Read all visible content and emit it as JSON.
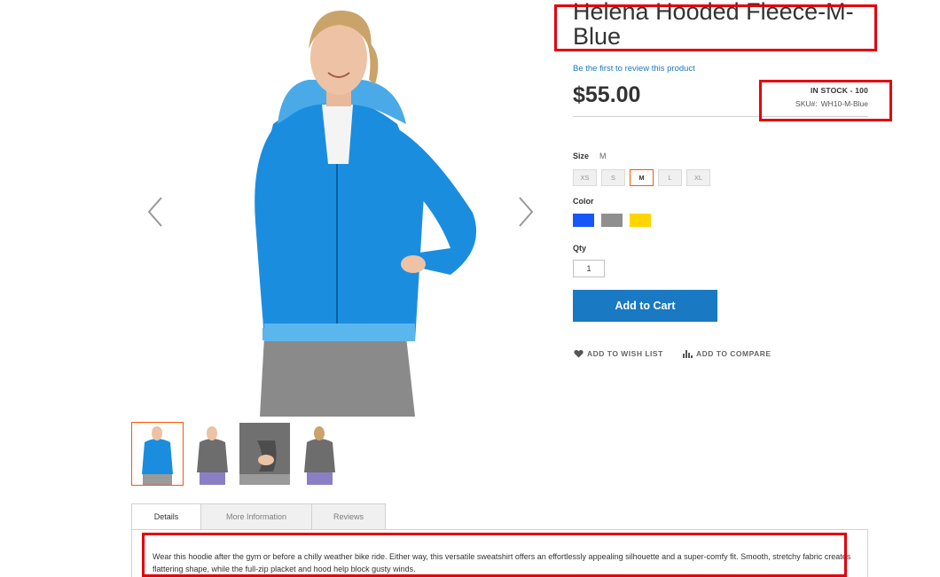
{
  "product": {
    "title": "Helena Hooded Fleece-M-Blue",
    "review_link": "Be the first to review this product",
    "price": "$55.00",
    "stock_status": "IN STOCK - 100",
    "sku_label": "SKU#:",
    "sku_value": "WH10-M-Blue"
  },
  "options": {
    "size_label": "Size",
    "size_selected": "M",
    "sizes": [
      "XS",
      "S",
      "M",
      "L",
      "XL"
    ],
    "color_label": "Color",
    "colors": [
      "#1857f7",
      "#8f8f8f",
      "#ffd500"
    ],
    "qty_label": "Qty",
    "qty_value": "1"
  },
  "actions": {
    "add_to_cart": "Add to Cart",
    "wish_list": "ADD TO WISH LIST",
    "compare": "ADD TO COMPARE"
  },
  "tabs": {
    "items": [
      "Details",
      "More Information",
      "Reviews"
    ],
    "active": "Details",
    "description": "Wear this hoodie after the gym or before a chilly weather bike ride. Either way, this versatile sweatshirt offers an effortlessly appealing silhouette and a super-comfy fit. Smooth, stretchy fabric creates flattering shape, while the full-zip placket and hood help block gusty winds."
  },
  "colors": {
    "accent": "#1979c3",
    "highlight": "#e3000b",
    "selected_border": "#ff5501"
  }
}
